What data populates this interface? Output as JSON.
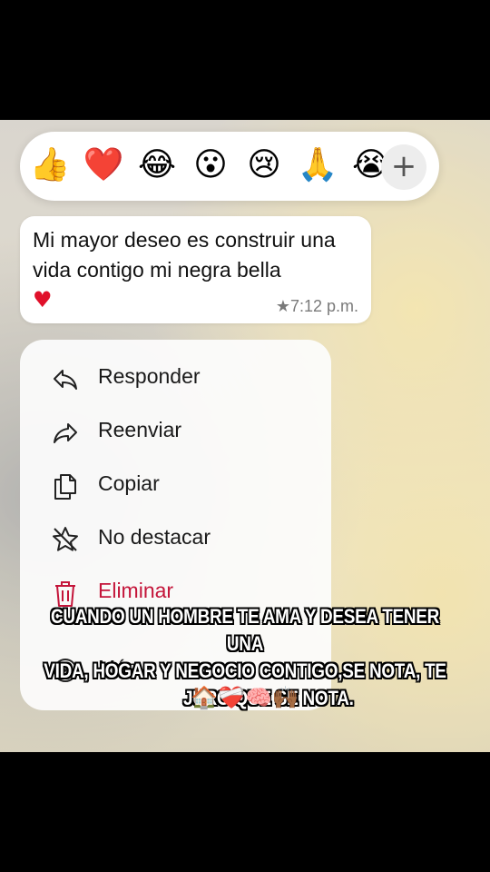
{
  "reactions": [
    "👍",
    "❤️",
    "😂",
    "😮",
    "😢",
    "🙏",
    "😭"
  ],
  "add_reaction_symbol": "+",
  "message": {
    "text": "Mi mayor deseo es construir una vida contigo mi negra bella",
    "emoji": "♥",
    "star": "★",
    "time": "7:12 p.m."
  },
  "menu": {
    "items": [
      {
        "label": "Responder",
        "icon": "reply-icon"
      },
      {
        "label": "Reenviar",
        "icon": "forward-icon"
      },
      {
        "label": "Copiar",
        "icon": "copy-icon"
      },
      {
        "label": "No destacar",
        "icon": "unstar-icon"
      },
      {
        "label": "Eliminar",
        "icon": "trash-icon"
      },
      {
        "label": "Más...",
        "icon": "more-icon"
      }
    ],
    "danger_color": "#c4153a"
  },
  "caption": {
    "lines": [
      "CUANDO UN HOMBRE TE AMA Y DESEA TENER UNA",
      "VIDA, HOGAR Y NEGOCIO CONTIGO,SE NOTA, TE",
      "JURO QUE SE NOTA."
    ],
    "emojis": "🏠❤️‍🩹🧠🙌🏾"
  }
}
